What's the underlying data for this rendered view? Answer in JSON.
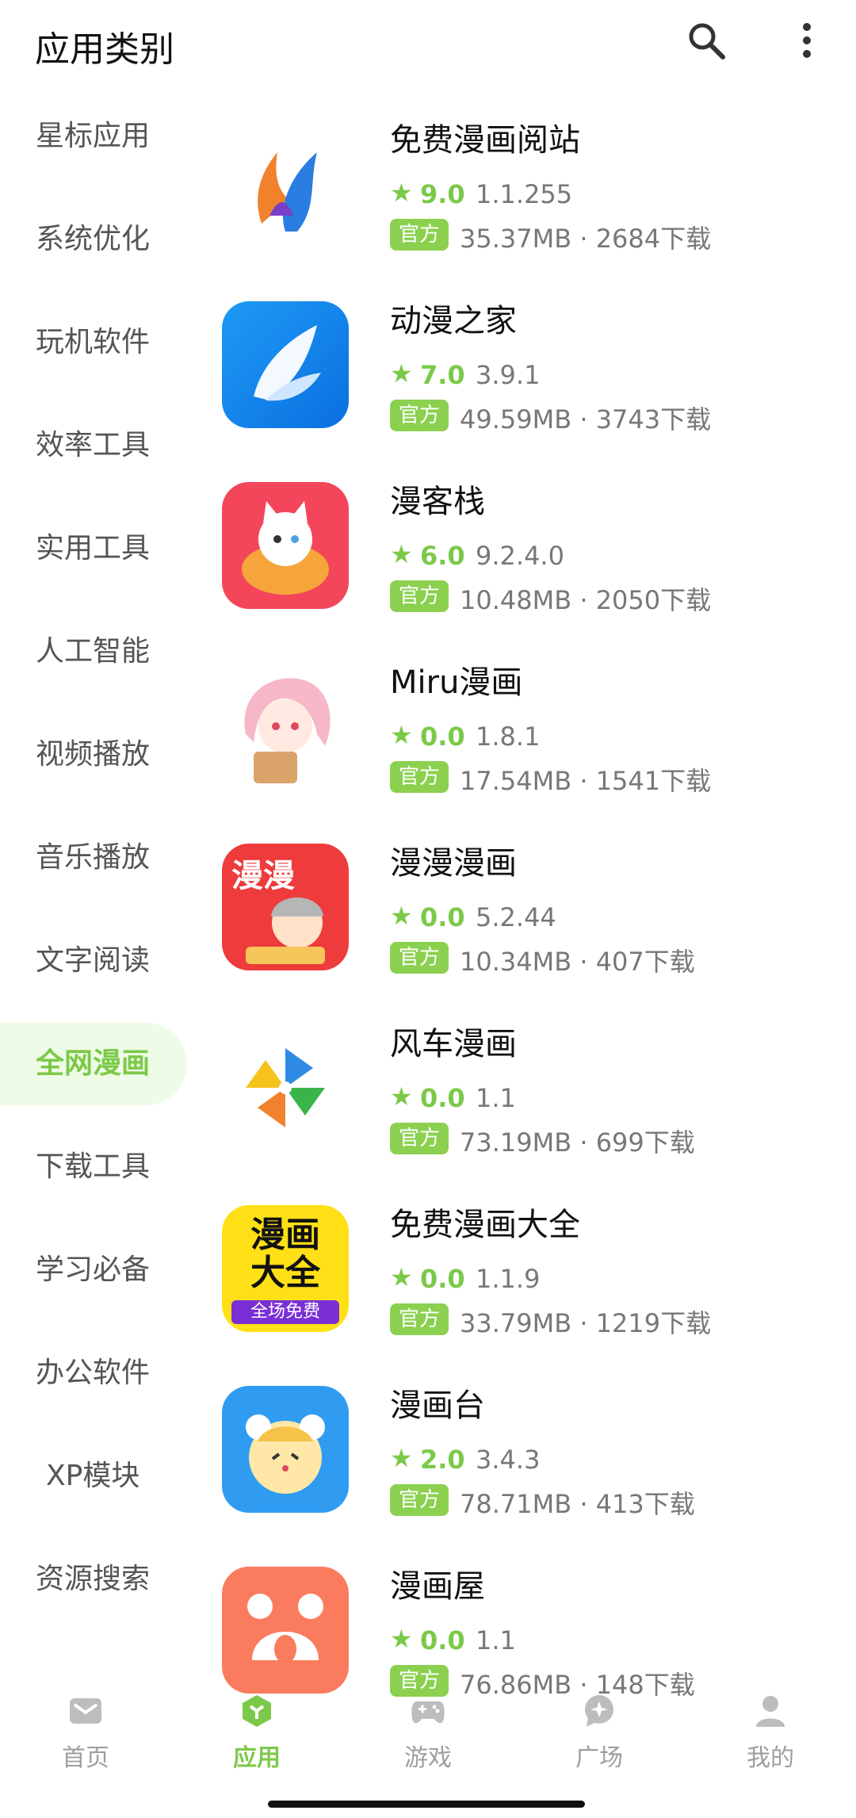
{
  "header": {
    "title": "应用类别",
    "icons": [
      "search-icon",
      "more-vert-icon"
    ]
  },
  "sidebar": {
    "items": [
      {
        "label": "星标应用"
      },
      {
        "label": "系统优化"
      },
      {
        "label": "玩机软件"
      },
      {
        "label": "效率工具"
      },
      {
        "label": "实用工具"
      },
      {
        "label": "人工智能"
      },
      {
        "label": "视频播放"
      },
      {
        "label": "音乐播放"
      },
      {
        "label": "文字阅读"
      },
      {
        "label": "全网漫画",
        "active": true
      },
      {
        "label": "下载工具"
      },
      {
        "label": "学习必备"
      },
      {
        "label": "办公软件"
      },
      {
        "label": "XP模块"
      },
      {
        "label": "资源搜索"
      }
    ]
  },
  "apps": [
    {
      "name": "免费漫画阅站",
      "rating": "9.0",
      "version": "1.1.255",
      "badge": "官方",
      "meta": "35.37MB · 2684下载"
    },
    {
      "name": "动漫之家",
      "rating": "7.0",
      "version": "3.9.1",
      "badge": "官方",
      "meta": "49.59MB · 3743下载"
    },
    {
      "name": "漫客栈",
      "rating": "6.0",
      "version": "9.2.4.0",
      "badge": "官方",
      "meta": "10.48MB · 2050下载"
    },
    {
      "name": "Miru漫画",
      "rating": "0.0",
      "version": "1.8.1",
      "badge": "官方",
      "meta": "17.54MB · 1541下载"
    },
    {
      "name": "漫漫漫画",
      "rating": "0.0",
      "version": "5.2.44",
      "badge": "官方",
      "meta": "10.34MB · 407下载",
      "icon_text": "漫漫"
    },
    {
      "name": "风车漫画",
      "rating": "0.0",
      "version": "1.1",
      "badge": "官方",
      "meta": "73.19MB · 699下载"
    },
    {
      "name": "免费漫画大全",
      "rating": "0.0",
      "version": "1.1.9",
      "badge": "官方",
      "meta": "33.79MB · 1219下载",
      "icon_text": "漫画大全",
      "icon_sub": "全场免费"
    },
    {
      "name": "漫画台",
      "rating": "2.0",
      "version": "3.4.3",
      "badge": "官方",
      "meta": "78.71MB · 413下载"
    },
    {
      "name": "漫画屋",
      "rating": "0.0",
      "version": "1.1",
      "badge": "官方",
      "meta": "76.86MB · 148下载"
    }
  ],
  "tabbar": {
    "tabs": [
      {
        "label": "首页",
        "icon": "mail-icon"
      },
      {
        "label": "应用",
        "icon": "cube-icon",
        "active": true
      },
      {
        "label": "游戏",
        "icon": "gamepad-icon"
      },
      {
        "label": "广场",
        "icon": "chat-bubble-icon"
      },
      {
        "label": "我的",
        "icon": "person-icon"
      }
    ]
  },
  "colors": {
    "accent": "#7cc94a",
    "badge": "#8bd04f",
    "active_bg": "#eefbe6"
  }
}
